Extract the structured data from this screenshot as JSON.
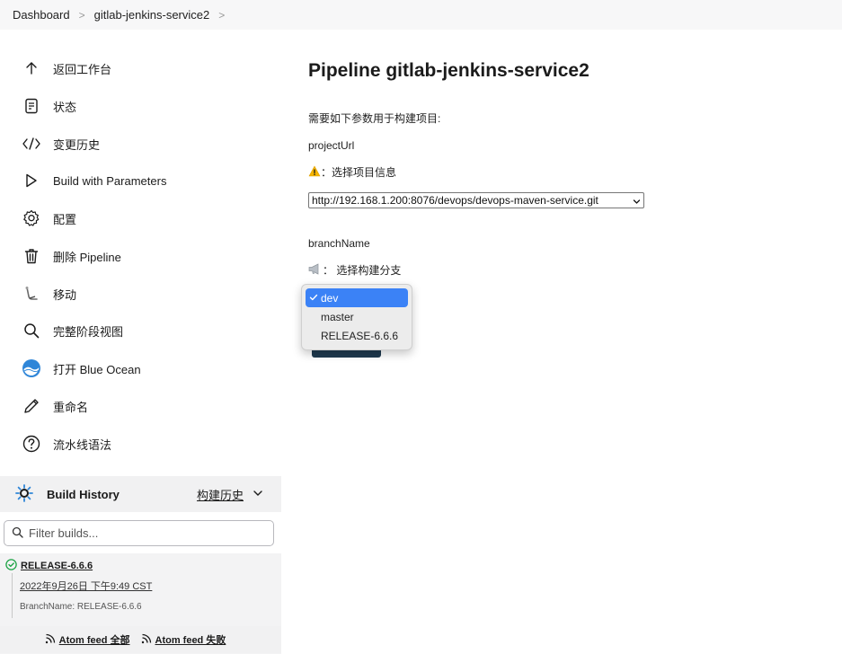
{
  "breadcrumb": {
    "items": [
      "Dashboard",
      "gitlab-jenkins-service2"
    ]
  },
  "sidebar": {
    "items": [
      {
        "label": "返回工作台",
        "icon": "arrow-up-icon"
      },
      {
        "label": "状态",
        "icon": "document-icon"
      },
      {
        "label": "变更历史",
        "icon": "code-icon"
      },
      {
        "label": "Build with Parameters",
        "icon": "play-icon"
      },
      {
        "label": "配置",
        "icon": "gear-icon"
      },
      {
        "label": "删除 Pipeline",
        "icon": "trash-icon"
      },
      {
        "label": "移动",
        "icon": "move-icon"
      },
      {
        "label": "完整阶段视图",
        "icon": "search-icon"
      },
      {
        "label": "打开 Blue Ocean",
        "icon": "blue-ocean-icon"
      },
      {
        "label": "重命名",
        "icon": "pencil-icon"
      },
      {
        "label": "流水线语法",
        "icon": "help-icon"
      }
    ]
  },
  "build_history": {
    "title": "Build History",
    "trend_label": "构建历史",
    "filter_placeholder": "Filter builds...",
    "builds": [
      {
        "name": "RELEASE-6.6.6",
        "time": "2022年9月26日 下午9:49 CST",
        "param": "BranchName: RELEASE-6.6.6",
        "status": "success"
      }
    ],
    "feed_all": "Atom feed 全部",
    "feed_failed": "Atom feed 失败"
  },
  "main": {
    "title": "Pipeline gitlab-jenkins-service2",
    "intro": "需要如下参数用于构建项目:",
    "params": [
      {
        "name": "projectUrl",
        "desc": "：选择项目信息",
        "value": "http://192.168.1.200:8076/devops/devops-maven-service.git"
      },
      {
        "name": "branchName",
        "desc": "：  选择构建分支"
      }
    ],
    "dropdown_options": [
      "dev",
      "master",
      "RELEASE-6.6.6"
    ],
    "dropdown_selected": "dev"
  },
  "colors": {
    "accent": "#3b82f6",
    "success": "#1ea446",
    "warning": "#f5b400",
    "button_dark": "#1f3a4f"
  }
}
